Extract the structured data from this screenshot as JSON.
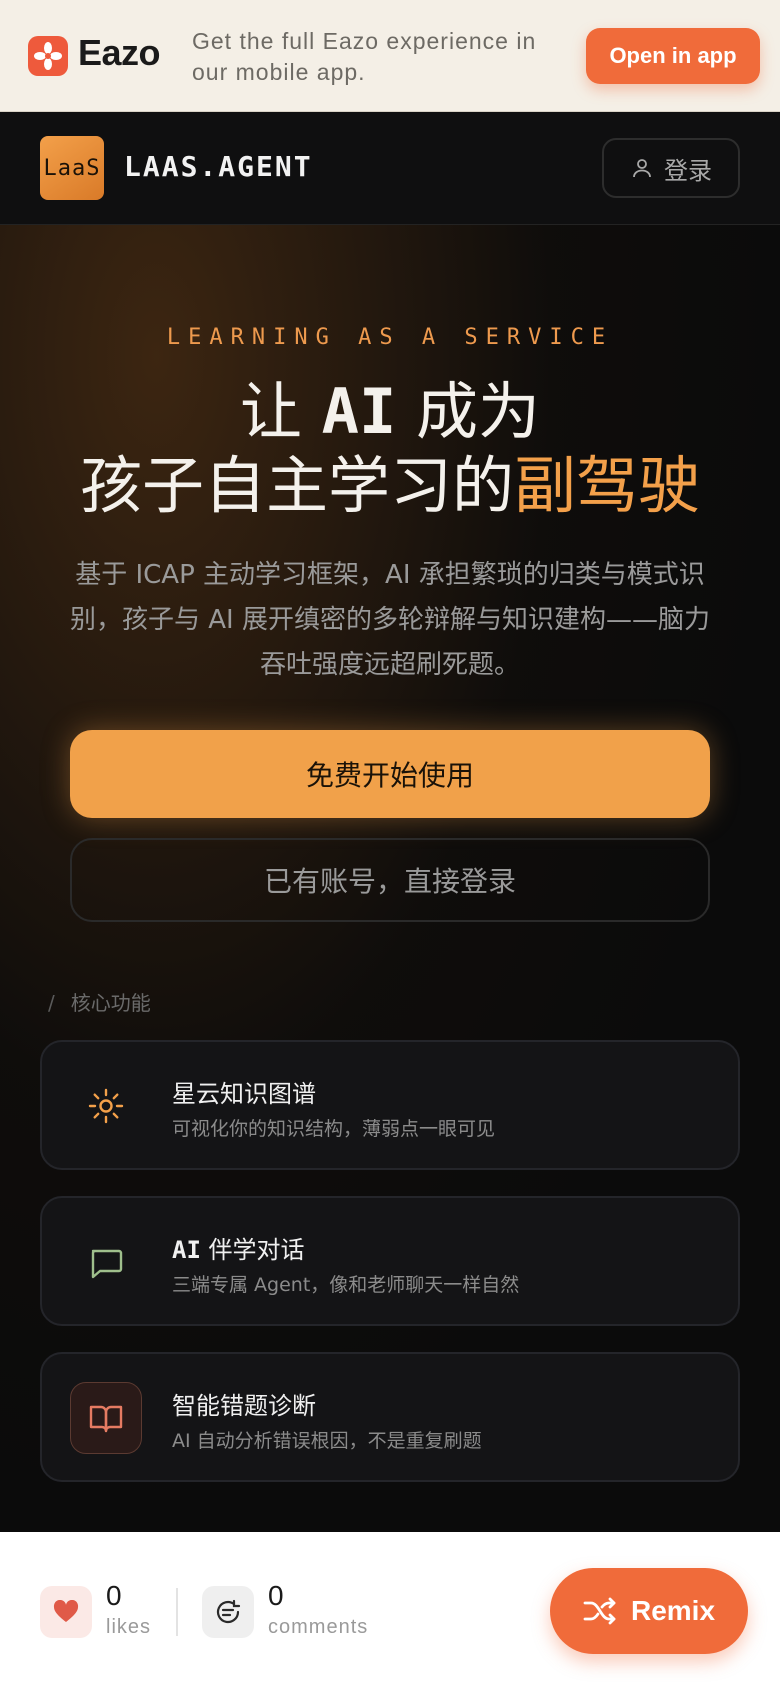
{
  "banner": {
    "brand": "Eazo",
    "promo": "Get the full Eazo experience in our mobile app.",
    "open_label": "Open in app"
  },
  "nav": {
    "logo_text": "LaaS",
    "app_name": "LAAS.AGENT",
    "login_label": "登录"
  },
  "hero": {
    "kicker": "LEARNING AS A SERVICE",
    "headline_line1_a": "让 ",
    "headline_line1_ai": "AI",
    "headline_line1_b": " 成为",
    "headline_line2_a": "孩子自主学习的",
    "headline_line2_accent": "副驾驶",
    "description": "基于 ICAP 主动学习框架，AI 承担繁琐的归类与模式识别，孩子与 AI 展开缜密的多轮辩解与知识建构——脑力吞吐强度远超刷死题。",
    "primary_cta": "免费开始使用",
    "secondary_cta": "已有账号，直接登录"
  },
  "features": {
    "section_slash": "/",
    "section_label": "核心功能",
    "items": [
      {
        "title_a": "",
        "title_mono": "",
        "title_b": "星云知识图谱",
        "subtitle": "可视化你的知识结构，薄弱点一眼可见",
        "icon": "sun-icon"
      },
      {
        "title_a": "",
        "title_mono": "AI",
        "title_b": " 伴学对话",
        "subtitle": "三端专属 Agent，像和老师聊天一样自然",
        "icon": "chat-bubble-icon"
      },
      {
        "title_a": "",
        "title_mono": "",
        "title_b": "智能错题诊断",
        "subtitle": "AI 自动分析错误根因，不是重复刷题",
        "icon": "open-book-icon"
      }
    ]
  },
  "bottom": {
    "likes_count": "0",
    "likes_label": "likes",
    "comments_count": "0",
    "comments_label": "comments",
    "remix_label": "Remix"
  },
  "colors": {
    "accent": "#f1a14a",
    "brand": "#f06b3a",
    "background": "#0b0b0b"
  }
}
